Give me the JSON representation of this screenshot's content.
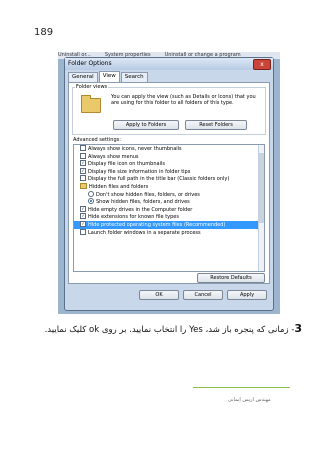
{
  "page_number": "189",
  "background_strip": [
    "Uninstall or...",
    "System properties",
    "Uninstall or change a program"
  ],
  "dialog": {
    "title": "Folder Options",
    "close_glyph": "x",
    "tabs": [
      {
        "label": "General",
        "active": false
      },
      {
        "label": "View",
        "active": true
      },
      {
        "label": "Search",
        "active": false
      }
    ],
    "folder_views": {
      "label": "Folder views",
      "description": "You can apply the view (such as Details or Icons) that you are using for this folder to all folders of this type.",
      "apply_button": "Apply to Folders",
      "reset_button": "Reset Folders"
    },
    "advanced_label": "Advanced settings:",
    "settings": [
      {
        "type": "checkbox",
        "label": "Always show icons, never thumbnails",
        "checked": false,
        "indent": 1
      },
      {
        "type": "checkbox",
        "label": "Always show menus",
        "checked": false,
        "indent": 1
      },
      {
        "type": "checkbox",
        "label": "Display file icon on thumbnails",
        "checked": true,
        "indent": 1
      },
      {
        "type": "checkbox",
        "label": "Display file size information in folder tips",
        "checked": true,
        "indent": 1
      },
      {
        "type": "checkbox",
        "label": "Display the full path in the title bar (Classic folders only)",
        "checked": false,
        "indent": 1
      },
      {
        "type": "folder",
        "label": "Hidden files and folders",
        "indent": 1
      },
      {
        "type": "radio",
        "label": "Don't show hidden files, folders, or drives",
        "checked": false,
        "indent": 2
      },
      {
        "type": "radio",
        "label": "Show hidden files, folders, and drives",
        "checked": true,
        "indent": 2
      },
      {
        "type": "checkbox",
        "label": "Hide empty drives in the Computer folder",
        "checked": true,
        "indent": 1
      },
      {
        "type": "checkbox",
        "label": "Hide extensions for known file types",
        "checked": true,
        "indent": 1
      },
      {
        "type": "checkbox",
        "label": "Hide protected operating system files (Recommended)",
        "checked": true,
        "indent": 1,
        "selected": true
      },
      {
        "type": "checkbox",
        "label": "Launch folder windows in a separate process",
        "checked": false,
        "indent": 1
      }
    ],
    "restore_button": "Restore Defaults",
    "ok_button": "OK",
    "cancel_button": "Cancel",
    "apply_button": "Apply"
  },
  "instruction": {
    "number": "3",
    "text": "- زمانی که پنجره باز شد، Yes را انتخاب نمایید. بر روی ok کلیک نمایید."
  },
  "footer": {
    "author": "مهندس اریس ایمانی"
  },
  "colors": {
    "selection": "#3399ff",
    "footer_line": "#8cbf43"
  }
}
